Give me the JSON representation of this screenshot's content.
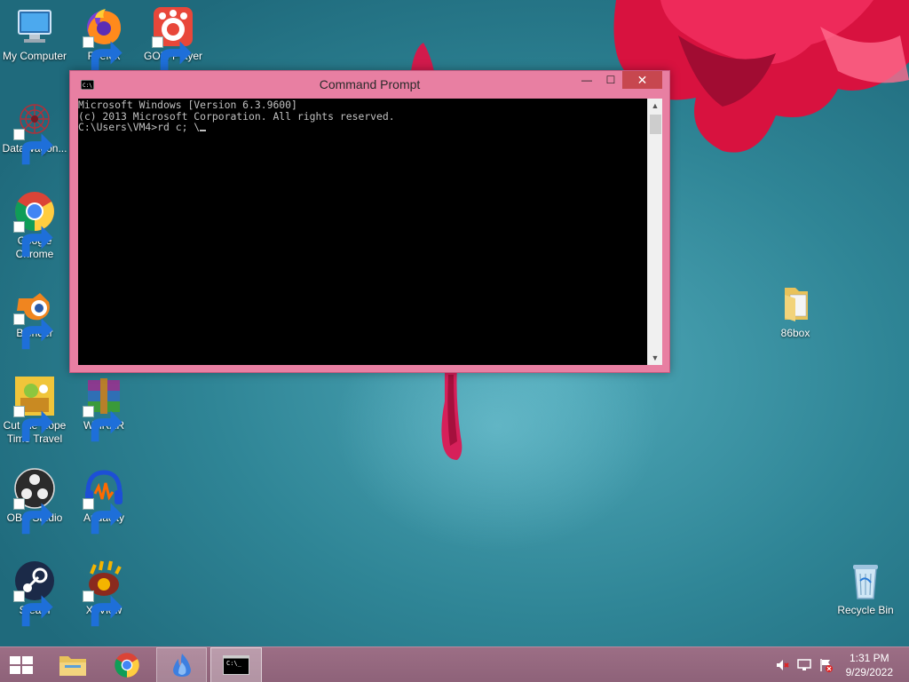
{
  "desktop": {
    "icons": [
      {
        "label": "My Computer"
      },
      {
        "label": "Firefox"
      },
      {
        "label": "GOM Player"
      },
      {
        "label": "DataWagon..."
      },
      {
        "label": "Google Chrome"
      },
      {
        "label": "Blender"
      },
      {
        "label": "Cut the Rope Time Travel"
      },
      {
        "label": "WinRAR"
      },
      {
        "label": "OBS Studio"
      },
      {
        "label": "Audacity"
      },
      {
        "label": "Steam"
      },
      {
        "label": "XnView"
      },
      {
        "label": "86box"
      },
      {
        "label": "Recycle Bin"
      }
    ]
  },
  "cmd": {
    "title": "Command Prompt",
    "app_icon_text": "C:\\_",
    "lines": [
      "Microsoft Windows [Version 6.3.9600]",
      "(c) 2013 Microsoft Corporation. All rights reserved.",
      "",
      "C:\\Users\\VM4>rd c; \\"
    ],
    "buttons": {
      "minimize": "—",
      "maximize": "☐",
      "close": "✕"
    }
  },
  "taskbar": {
    "cmd_thumb_text": "C:\\_",
    "clock_time": "1:31 PM",
    "clock_date": "9/29/2022"
  },
  "colors": {
    "window_frame": "#e87fa2",
    "close_button": "#c7474f",
    "taskbar": "#8e6279",
    "console_bg": "#000000",
    "console_text": "#c0c0c0"
  }
}
